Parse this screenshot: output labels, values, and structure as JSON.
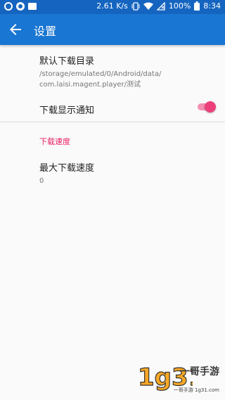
{
  "status_bar": {
    "speed": "2.61 K/s",
    "battery": "100%",
    "time": "8:34",
    "icons": [
      "record-icon",
      "timer-icon",
      "image-icon",
      "vibrate-icon",
      "wifi-icon",
      "signal-off-icon",
      "battery-icon"
    ]
  },
  "app_bar": {
    "title": "设置",
    "back_icon": "arrow-left-icon"
  },
  "preferences": {
    "download_dir": {
      "title": "默认下载目录",
      "summary_line1": "/storage/emulated/0/Android/data/",
      "summary_line2": "com.laisi.magent.player/测试"
    },
    "notify": {
      "title": "下载显示通知",
      "enabled": true
    },
    "speed_category": "下载速度",
    "max_speed": {
      "title": "最大下载速度",
      "value": "0"
    }
  },
  "watermark": {
    "logo_text": "1g31",
    "brand": "一哥手游",
    "tagline": "一哥手游 1g31.com"
  },
  "colors": {
    "status_bar": "#1565c0",
    "app_bar": "#1976d2",
    "accent": "#e91e63"
  }
}
